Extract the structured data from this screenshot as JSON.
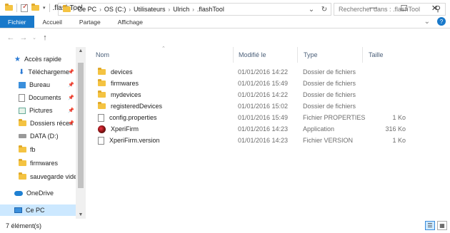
{
  "window": {
    "title": ".flashTool",
    "controls": {
      "minimize": "—",
      "maximize": "☐",
      "close": "✕"
    }
  },
  "ribbon": {
    "tabs": [
      "Fichier",
      "Accueil",
      "Partage",
      "Affichage"
    ],
    "expand_icon": "⌄",
    "help_icon": "?"
  },
  "address": {
    "segments": [
      "Ce PC",
      "OS (C:)",
      "Utilisateurs",
      "Ulrich",
      ".flashTool"
    ],
    "search_placeholder": "Rechercher dans : .flashTool"
  },
  "nav": {
    "items": [
      {
        "label": "Accès rapide",
        "icon": "star-icon"
      },
      {
        "label": "Téléchargeme",
        "icon": "download-icon",
        "pinned": true
      },
      {
        "label": "Bureau",
        "icon": "desktop-icon",
        "pinned": true
      },
      {
        "label": "Documents",
        "icon": "documents-icon",
        "pinned": true
      },
      {
        "label": "Pictures",
        "icon": "pictures-icon",
        "pinned": true
      },
      {
        "label": "Dossiers récen",
        "icon": "recent-folder-icon",
        "pinned": true
      },
      {
        "label": "DATA (D:)",
        "icon": "drive-icon"
      },
      {
        "label": "fb",
        "icon": "folder-icon"
      },
      {
        "label": "firmwares",
        "icon": "folder-icon"
      },
      {
        "label": "sauvegarde  vide",
        "icon": "folder-icon"
      },
      {
        "label": "OneDrive",
        "icon": "onedrive-icon"
      },
      {
        "label": "Ce PC",
        "icon": "pc-icon",
        "selected": true
      }
    ]
  },
  "columns": {
    "name": "Nom",
    "modified": "Modifié le",
    "type": "Type",
    "size": "Taille"
  },
  "files": [
    {
      "name": "devices",
      "modified": "01/01/2016 14:22",
      "type": "Dossier de fichiers",
      "size": "",
      "icon": "folder-icon"
    },
    {
      "name": "firmwares",
      "modified": "01/01/2016 15:49",
      "type": "Dossier de fichiers",
      "size": "",
      "icon": "folder-icon"
    },
    {
      "name": "mydevices",
      "modified": "01/01/2016 14:22",
      "type": "Dossier de fichiers",
      "size": "",
      "icon": "folder-icon"
    },
    {
      "name": "registeredDevices",
      "modified": "01/01/2016 15:02",
      "type": "Dossier de fichiers",
      "size": "",
      "icon": "folder-icon"
    },
    {
      "name": "config.properties",
      "modified": "01/01/2016 15:49",
      "type": "Fichier PROPERTIES",
      "size": "1 Ko",
      "icon": "file-icon"
    },
    {
      "name": "XperiFirm",
      "modified": "01/01/2016 14:23",
      "type": "Application",
      "size": "316 Ko",
      "icon": "app-icon"
    },
    {
      "name": "XperiFirm.version",
      "modified": "01/01/2016 14:23",
      "type": "Fichier VERSION",
      "size": "1 Ko",
      "icon": "file-icon"
    }
  ],
  "status": {
    "count": "7 élément(s)"
  }
}
